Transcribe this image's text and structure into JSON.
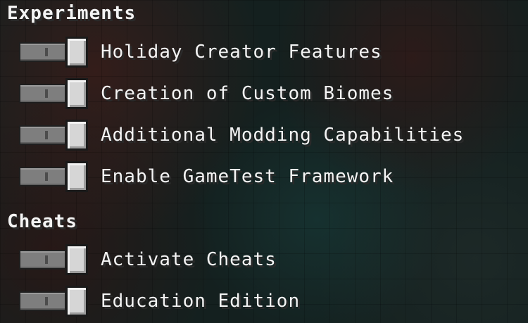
{
  "experiments": {
    "header": "Experiments",
    "items": [
      {
        "label": "Holiday Creator Features",
        "enabled": false
      },
      {
        "label": "Creation of Custom Biomes",
        "enabled": false
      },
      {
        "label": "Additional Modding Capabilities",
        "enabled": false
      },
      {
        "label": "Enable GameTest Framework",
        "enabled": false
      }
    ]
  },
  "cheats": {
    "header": "Cheats",
    "items": [
      {
        "label": "Activate Cheats",
        "enabled": false
      },
      {
        "label": "Education Edition",
        "enabled": false
      }
    ]
  }
}
